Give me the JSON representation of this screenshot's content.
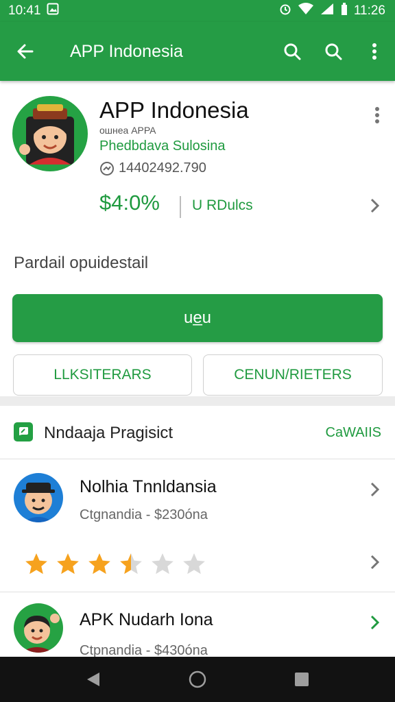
{
  "status_bar": {
    "time_left": "10:41",
    "time_right": "11:26"
  },
  "app_bar": {
    "title": "APP Indonesia"
  },
  "app_header": {
    "name": "APP Indonesia",
    "subtitle": "ошнеа APPA",
    "developer": "Phedbdava Sulosina",
    "app_id": "1440249⁠2.790",
    "price": "$4:0%",
    "price_label": "U RDulcs",
    "detail_text": "Pardail opuidestail",
    "install_label": "ue̲u",
    "button_left": "LLKSITERARS",
    "button_right": "CENUN/RIETERS"
  },
  "section": {
    "title": "Nndaaja Pragisict",
    "action": "CaWAIIS"
  },
  "list": [
    {
      "title": "Nolhia Tnnldansia",
      "subtitle": "Ctgnandia - $230óna",
      "rating": 3.5
    },
    {
      "title": "APK Nudarh Iona",
      "subtitle": "Ctpnandia - $430óna"
    }
  ],
  "colors": {
    "primary": "#259c45",
    "accent_text": "#1f9a3f",
    "star": "#f6a21e",
    "star_empty": "#d8d8d8"
  },
  "icons": [
    "back-arrow-icon",
    "search-icon",
    "more-vert-icon",
    "chevron-right-icon",
    "clock-icon",
    "star-icon",
    "nav-back-icon",
    "nav-home-icon",
    "nav-recents-icon"
  ]
}
